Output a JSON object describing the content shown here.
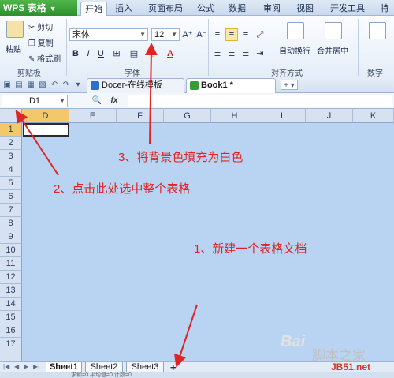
{
  "menubar": {
    "app_label": "WPS 表格",
    "tabs": [
      "开始",
      "插入",
      "页面布局",
      "公式",
      "数据",
      "审阅",
      "视图",
      "开发工具",
      "特"
    ]
  },
  "ribbon": {
    "clipboard": {
      "paste": "粘贴",
      "cut": "剪切",
      "copy": "复制",
      "format_painter": "格式刷",
      "label": "剪贴板"
    },
    "font": {
      "name": "宋体",
      "size": "12",
      "bold": "B",
      "italic": "I",
      "underline": "U",
      "grow": "A⁺",
      "shrink": "A⁻",
      "label": "字体"
    },
    "alignment": {
      "wrap": "自动换行",
      "merge": "合并居中",
      "label": "对齐方式"
    },
    "number": {
      "label": "数字"
    }
  },
  "doc_tabs": [
    {
      "label": "Docer-在线模板"
    },
    {
      "label": "Book1 *"
    }
  ],
  "formula_bar": {
    "name_box": "D1",
    "fx": "fx"
  },
  "grid": {
    "columns": [
      "D",
      "E",
      "F",
      "G",
      "H",
      "I",
      "J",
      "K"
    ],
    "rows": [
      "1",
      "2",
      "3",
      "4",
      "5",
      "6",
      "7",
      "8",
      "9",
      "10",
      "11",
      "12",
      "13",
      "14",
      "15",
      "16",
      "17"
    ]
  },
  "sheets": [
    "Sheet1",
    "Sheet2",
    "Sheet3"
  ],
  "add_sheet": "+",
  "status": "求和=0  平均值=0  计数=0",
  "annotations": {
    "step1": "1、新建一个表格文档",
    "step2": "2、点击此处选中整个表格",
    "step3": "3、将背景色填充为白色"
  },
  "colors": {
    "grid_bg": "#b9d3f2",
    "annotation": "#e02424",
    "accent_green": "#2e8f2c"
  },
  "watermarks": {
    "site1": "脚本之家",
    "site2": "JB51.net",
    "baidu": "Bai"
  }
}
